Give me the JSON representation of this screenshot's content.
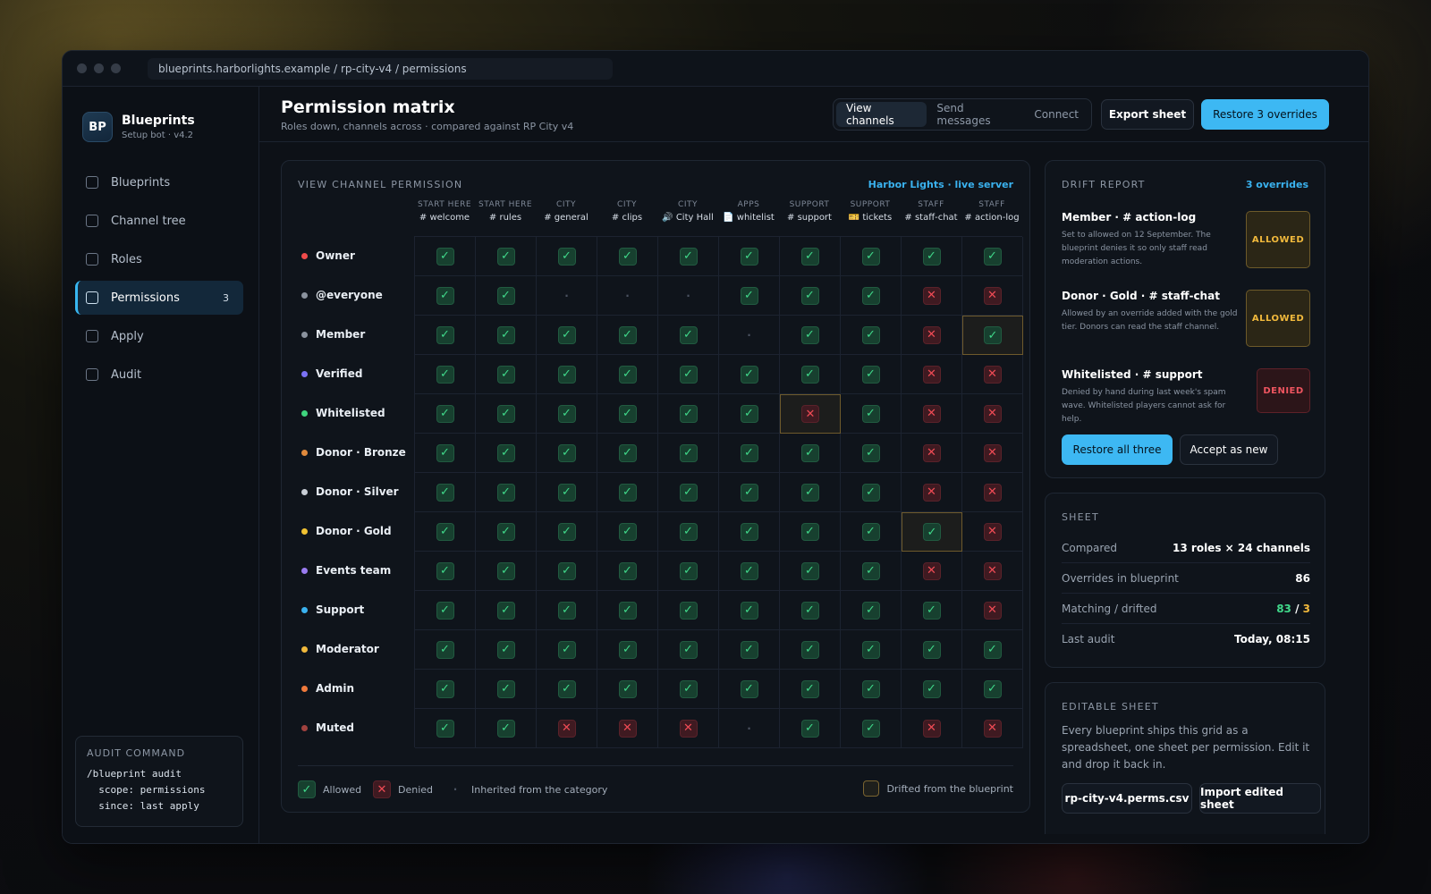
{
  "window": {
    "url": "blueprints.harborlights.example / rp-city-v4 / permissions"
  },
  "brand": {
    "initials": "BP",
    "name": "Blueprints",
    "sub": "Setup bot · v4.2"
  },
  "nav": [
    {
      "label": "Blueprints"
    },
    {
      "label": "Channel tree"
    },
    {
      "label": "Roles"
    },
    {
      "label": "Permissions",
      "count": "3",
      "active": true
    },
    {
      "label": "Apply"
    },
    {
      "label": "Audit"
    }
  ],
  "audit": {
    "title": "AUDIT COMMAND",
    "code": "/blueprint audit\n  scope: permissions\n  since: last apply"
  },
  "header": {
    "title": "Permission matrix",
    "subtitle": "Roles down, channels across · compared against RP City v4",
    "tabs": [
      "View channels",
      "Send messages",
      "Connect"
    ],
    "export_label": "Export sheet",
    "restore_label": "Restore 3 overrides"
  },
  "matrix": {
    "title": "VIEW CHANNEL PERMISSION",
    "server": "Harbor Lights · live server",
    "columns": [
      {
        "cat": "START HERE",
        "name": "# welcome"
      },
      {
        "cat": "START HERE",
        "name": "# rules"
      },
      {
        "cat": "CITY",
        "name": "# general"
      },
      {
        "cat": "CITY",
        "name": "# clips"
      },
      {
        "cat": "CITY",
        "name": "🔊 City Hall"
      },
      {
        "cat": "APPS",
        "name": "📄 whitelist"
      },
      {
        "cat": "SUPPORT",
        "name": "# support"
      },
      {
        "cat": "SUPPORT",
        "name": "🎫 tickets"
      },
      {
        "cat": "STAFF",
        "name": "# staff-chat"
      },
      {
        "cat": "STAFF",
        "name": "# action-log"
      }
    ],
    "rows": [
      {
        "role": "Owner",
        "color": "#ef4b4b",
        "cells": [
          "y",
          "y",
          "y",
          "y",
          "y",
          "y",
          "y",
          "y",
          "y",
          "y"
        ]
      },
      {
        "role": "@everyone",
        "color": "#8a929e",
        "cells": [
          "y",
          "y",
          "i",
          "i",
          "i",
          "y",
          "y",
          "y",
          "n",
          "n"
        ]
      },
      {
        "role": "Member",
        "color": "#8a929e",
        "cells": [
          "y",
          "y",
          "y",
          "y",
          "y",
          "i",
          "y",
          "y",
          "n",
          "y"
        ],
        "drift": [
          9
        ]
      },
      {
        "role": "Verified",
        "color": "#7b72f5",
        "cells": [
          "y",
          "y",
          "y",
          "y",
          "y",
          "y",
          "y",
          "y",
          "n",
          "n"
        ]
      },
      {
        "role": "Whitelisted",
        "color": "#3fd47e",
        "cells": [
          "y",
          "y",
          "y",
          "y",
          "y",
          "y",
          "n",
          "y",
          "n",
          "n"
        ],
        "drift": [
          6
        ]
      },
      {
        "role": "Donor · Bronze",
        "color": "#e08a3c",
        "cells": [
          "y",
          "y",
          "y",
          "y",
          "y",
          "y",
          "y",
          "y",
          "n",
          "n"
        ]
      },
      {
        "role": "Donor · Silver",
        "color": "#c9ced6",
        "cells": [
          "y",
          "y",
          "y",
          "y",
          "y",
          "y",
          "y",
          "y",
          "n",
          "n"
        ]
      },
      {
        "role": "Donor · Gold",
        "color": "#f1c232",
        "cells": [
          "y",
          "y",
          "y",
          "y",
          "y",
          "y",
          "y",
          "y",
          "y",
          "n"
        ],
        "drift": [
          8
        ]
      },
      {
        "role": "Events team",
        "color": "#9a7cf0",
        "cells": [
          "y",
          "y",
          "y",
          "y",
          "y",
          "y",
          "y",
          "y",
          "n",
          "n"
        ]
      },
      {
        "role": "Support",
        "color": "#3ab2ef",
        "cells": [
          "y",
          "y",
          "y",
          "y",
          "y",
          "y",
          "y",
          "y",
          "y",
          "n"
        ]
      },
      {
        "role": "Moderator",
        "color": "#f1b93c",
        "cells": [
          "y",
          "y",
          "y",
          "y",
          "y",
          "y",
          "y",
          "y",
          "y",
          "y"
        ]
      },
      {
        "role": "Admin",
        "color": "#f07a3c",
        "cells": [
          "y",
          "y",
          "y",
          "y",
          "y",
          "y",
          "y",
          "y",
          "y",
          "y"
        ]
      },
      {
        "role": "Muted",
        "color": "#a0423f",
        "cells": [
          "y",
          "y",
          "n",
          "n",
          "n",
          "i",
          "y",
          "y",
          "n",
          "n"
        ]
      }
    ],
    "legend": {
      "allowed": "Allowed",
      "denied": "Denied",
      "inherited": "Inherited from the category",
      "drift": "Drifted from the blueprint"
    }
  },
  "drift_report": {
    "title": "DRIFT REPORT",
    "link": "3 overrides",
    "items": [
      {
        "name": "Member · # action-log",
        "desc": "Set to allowed on 12 September. The blueprint denies it so only staff read moderation actions.",
        "badge": "ALLOWED"
      },
      {
        "name": "Donor · Gold · # staff-chat",
        "desc": "Allowed by an override added with the gold tier. Donors can read the staff channel.",
        "badge": "ALLOWED"
      },
      {
        "name": "Whitelisted · # support",
        "desc": "Denied by hand during last week's spam wave. Whitelisted players cannot ask for help.",
        "badge": "DENIED"
      }
    ],
    "restore_label": "Restore all three",
    "accept_label": "Accept as new"
  },
  "sheet": {
    "title": "SHEET",
    "rows": [
      {
        "k": "Compared",
        "v": "13 roles × 24 channels"
      },
      {
        "k": "Overrides in blueprint",
        "v": "86"
      },
      {
        "k": "Matching / drifted",
        "matching": "83",
        "sep": " / ",
        "drifted": "3"
      },
      {
        "k": "Last audit",
        "v": "Today, 08:15"
      }
    ]
  },
  "editable": {
    "title": "EDITABLE SHEET",
    "text": "Every blueprint ships this grid as a spreadsheet, one sheet per permission. Edit it and drop it back in.",
    "file_label": "rp-city-v4.perms.csv",
    "import_label": "Import edited sheet"
  },
  "colors": {
    "accent": "#3db8f3",
    "allowed": "#40d88a",
    "denied": "#ef4b55",
    "drift": "#f1b93c"
  }
}
